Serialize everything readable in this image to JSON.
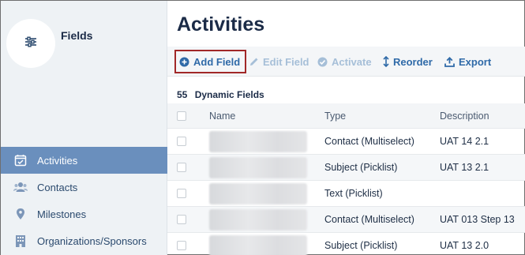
{
  "sidebar": {
    "app_title": "Fields",
    "logo_icon": "sliders-icon",
    "items": [
      {
        "label": "Activities",
        "icon": "calendar-check-icon",
        "active": true
      },
      {
        "label": "Contacts",
        "icon": "users-icon",
        "active": false
      },
      {
        "label": "Milestones",
        "icon": "map-pin-icon",
        "active": false
      },
      {
        "label": "Organizations/Sponsors",
        "icon": "building-icon",
        "active": false
      }
    ]
  },
  "main": {
    "title": "Activities",
    "toolbar": {
      "add_field": "Add Field",
      "edit_field": "Edit Field",
      "activate": "Activate",
      "reorder": "Reorder",
      "export": "Export"
    },
    "count": "55",
    "count_label": "Dynamic Fields",
    "table": {
      "headers": {
        "name": "Name",
        "type": "Type",
        "description": "Description"
      },
      "rows": [
        {
          "type": "Contact (Multiselect)",
          "description": "UAT 14 2.1"
        },
        {
          "type": "Subject (Picklist)",
          "description": "UAT 13 2.1"
        },
        {
          "type": "Text (Picklist)",
          "description": ""
        },
        {
          "type": "Contact (Multiselect)",
          "description": "UAT 013 Step 13"
        },
        {
          "type": "Subject (Picklist)",
          "description": "UAT 13 2.0"
        }
      ]
    }
  },
  "colors": {
    "accent": "#2f6aa8",
    "active_nav": "#6a8fbd",
    "title": "#1b2b47",
    "highlight_border": "#a12828"
  }
}
